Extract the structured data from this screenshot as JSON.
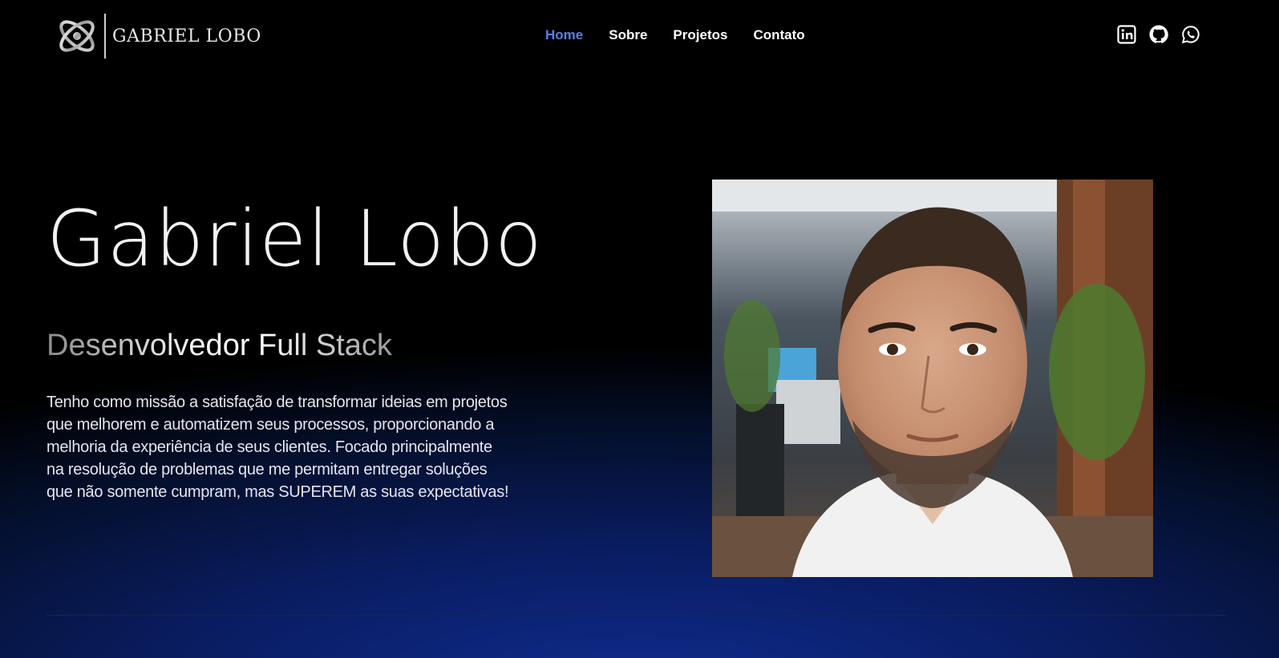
{
  "brand": {
    "name": "GABRIEL LOBO",
    "logo_icon": "orbit-logo-icon"
  },
  "nav": {
    "items": [
      {
        "label": "Home",
        "active": true
      },
      {
        "label": "Sobre",
        "active": false
      },
      {
        "label": "Projetos",
        "active": false
      },
      {
        "label": "Contato",
        "active": false
      }
    ]
  },
  "social": [
    "linkedin-icon",
    "github-icon",
    "whatsapp-icon"
  ],
  "hero": {
    "name": "Gabriel Lobo",
    "role": "Desenvolvedor Full Stack",
    "description": "Tenho como missão a satisfação de transformar ideias em projetos que melhorem e automatizem seus processos, proporcionando a melhoria da experiência de seus clientes. Focado principalmente na resolução de problemas que me permitam entregar soluções que não somente cumpram, mas SUPEREM as suas expectativas!"
  },
  "colors": {
    "accent": "#5a7fe6",
    "background": "#000000",
    "gradient_blue": "#0f2c8f"
  }
}
